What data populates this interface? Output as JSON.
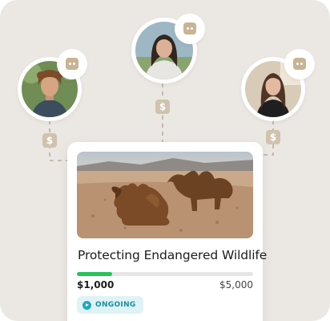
{
  "campaign": {
    "title": "Protecting Endangered Wildlife",
    "raised": "$1,000",
    "goal": "$5,000",
    "progress_fraction": 0.2,
    "status": "ONGOING",
    "image": "two camels resting in the desert"
  },
  "donors": [
    {
      "name": "",
      "photo": "young man with curly hair outdoors"
    },
    {
      "name": "",
      "photo": "young woman with long dark hair"
    },
    {
      "name": "",
      "photo": "young woman with long hair indoors"
    }
  ],
  "icons": {
    "message": "chat-bubble-icon",
    "donation": "dollar-icon",
    "status": "play-icon"
  },
  "colors": {
    "background": "#ebe8e3",
    "progress": "#26c25a",
    "status_text": "#1a8ea1",
    "status_bg": "#dff3f6",
    "accent_tan": "#c8b393"
  }
}
